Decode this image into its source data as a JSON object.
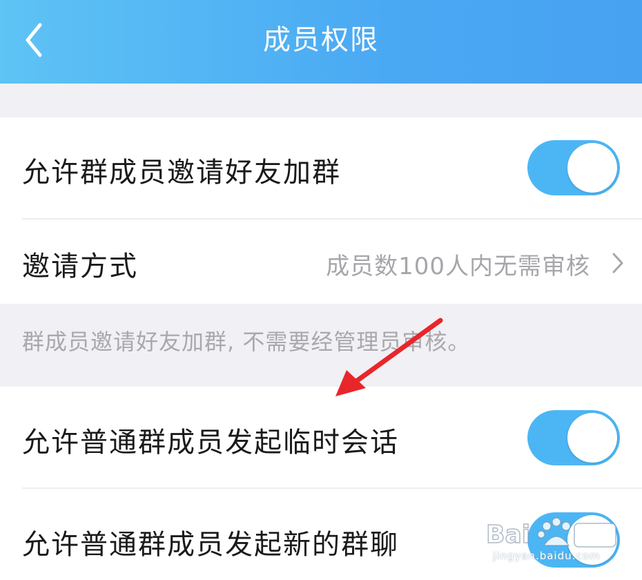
{
  "header": {
    "title": "成员权限",
    "back_icon": "chevron-left-icon"
  },
  "settings": {
    "invite_friends": {
      "label": "允许群成员邀请好友加群",
      "enabled": true
    },
    "invite_method": {
      "label": "邀请方式",
      "value": "成员数100人内无需审核",
      "icon": "chevron-right-icon"
    },
    "invite_note": "群成员邀请好友加群, 不需要经管理员审核。",
    "temp_chat": {
      "label": "允许普通群成员发起临时会话",
      "enabled": true
    },
    "new_group_chat": {
      "label": "允许普通群成员发起新的群聊",
      "enabled": true
    }
  },
  "overlay": {
    "arrow_color": "#e8262a",
    "watermark_url": "jingyan.baidu.com"
  },
  "colors": {
    "header_start": "#5ec3f5",
    "header_end": "#47a2f2",
    "toggle_on": "#4cb6f5",
    "page_background": "#f0f0f5"
  }
}
